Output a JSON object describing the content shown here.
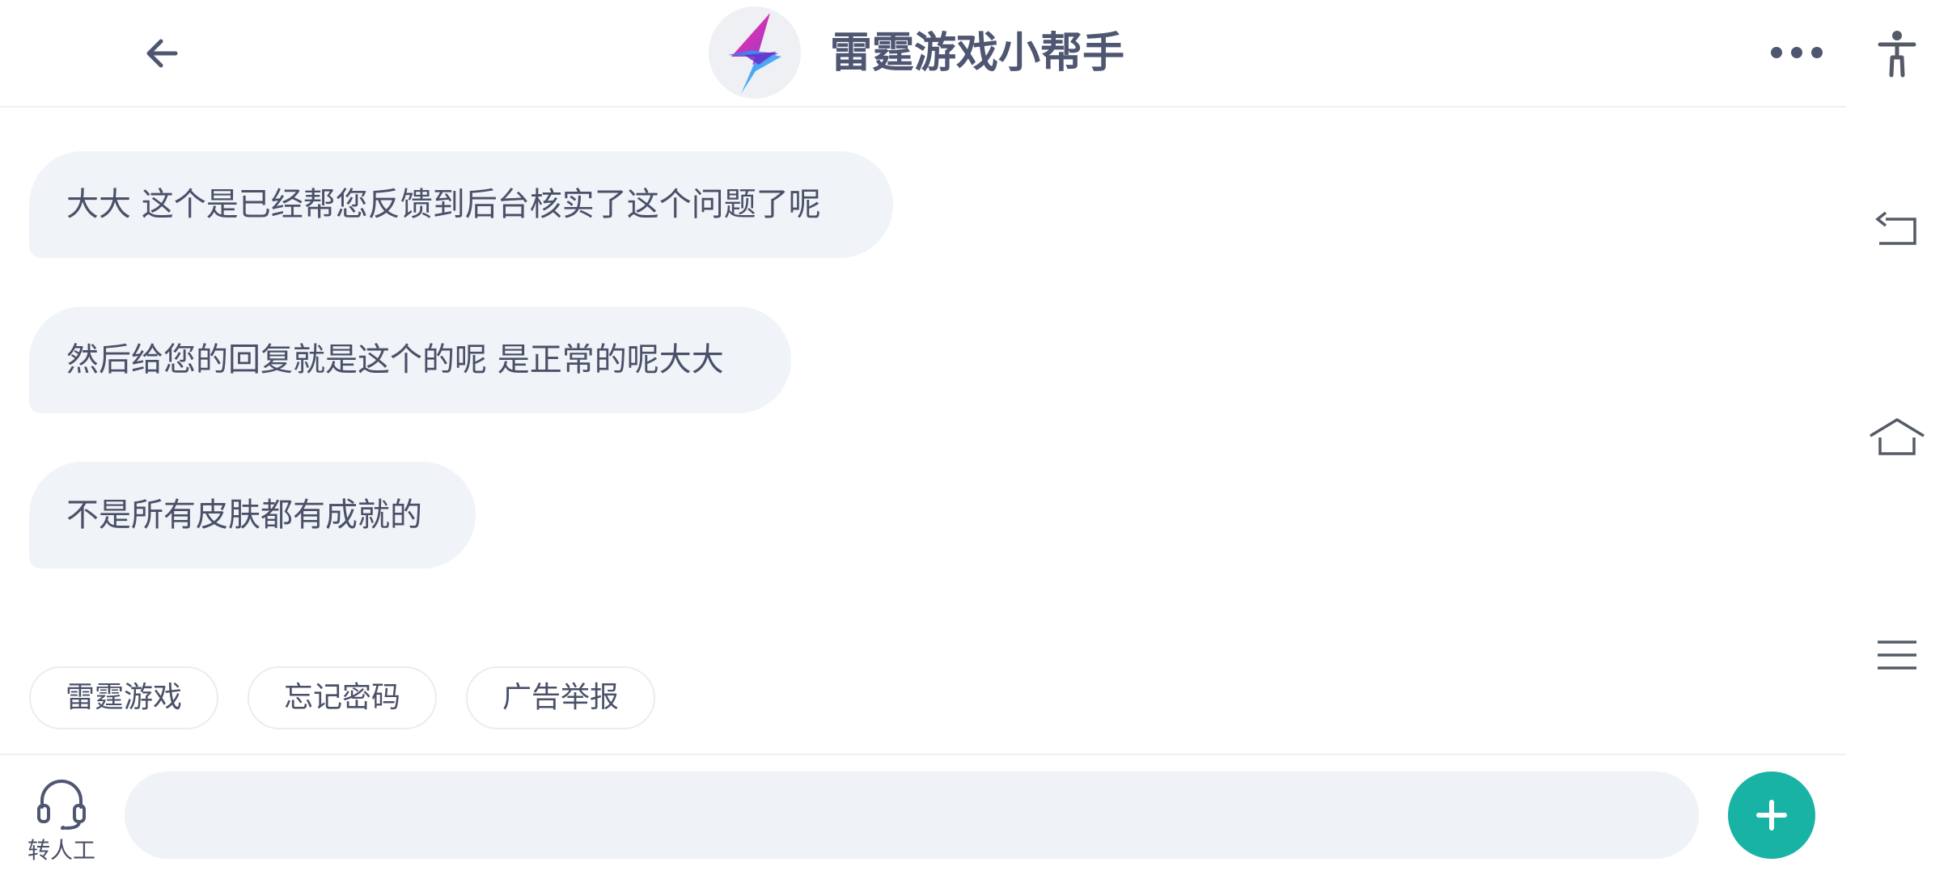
{
  "header": {
    "title": "雷霆游戏小帮手",
    "back_icon": "arrow-left-icon",
    "avatar_icon": "lightning-logo-icon",
    "more_icon": "more-dots-icon"
  },
  "messages": [
    {
      "text": "大大 这个是已经帮您反馈到后台核实了这个问题了呢"
    },
    {
      "text": "然后给您的回复就是这个的呢 是正常的呢大大"
    },
    {
      "text": "不是所有皮肤都有成就的"
    }
  ],
  "quick_replies": [
    {
      "label": "雷霆游戏"
    },
    {
      "label": "忘记密码"
    },
    {
      "label": "广告举报"
    }
  ],
  "bottom_bar": {
    "agent_label": "转人工",
    "agent_icon": "headset-icon",
    "input_value": "",
    "plus_icon": "plus-icon"
  },
  "system_nav": {
    "icons": [
      "accessibility-icon",
      "back-icon",
      "home-icon",
      "menu-icon"
    ]
  },
  "colors": {
    "accent": "#19b3a5",
    "text": "#4a5068",
    "bubble": "#f0f3f7"
  }
}
